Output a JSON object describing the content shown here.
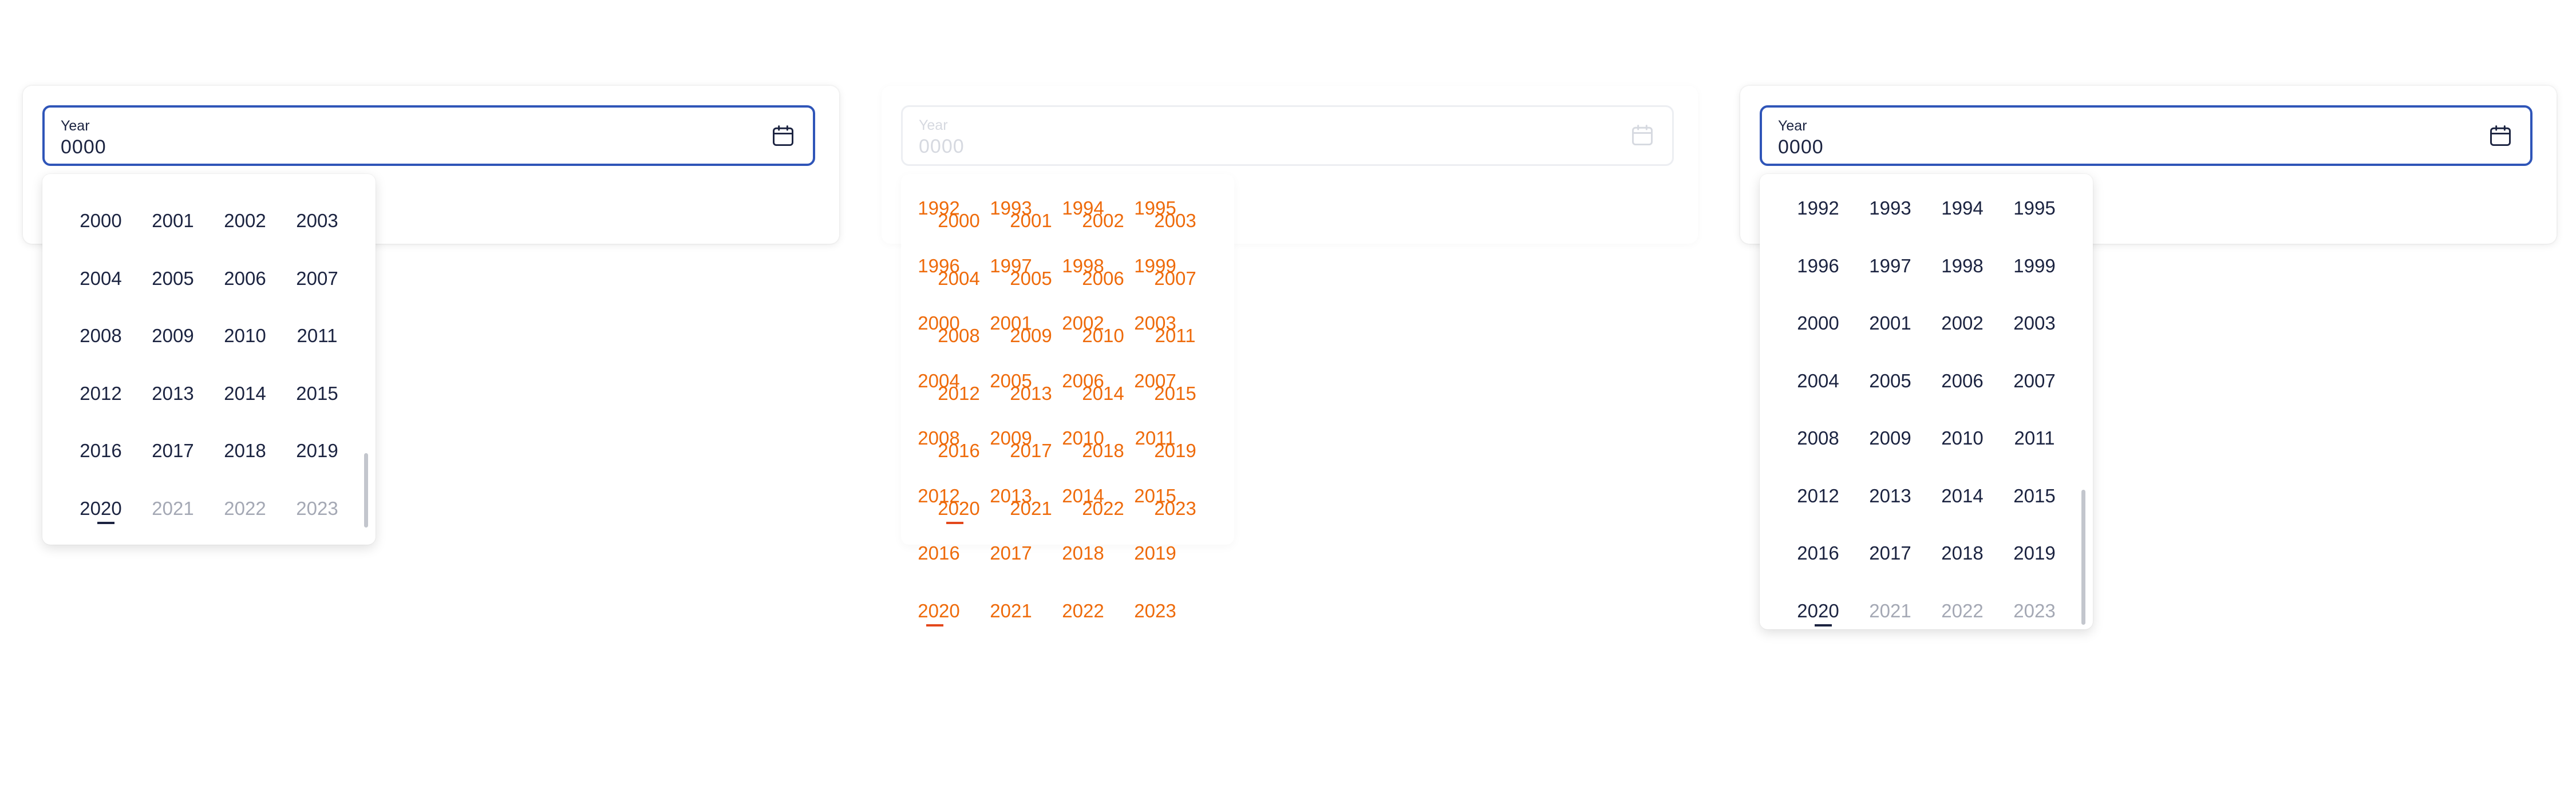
{
  "field": {
    "label": "Year",
    "value": "0000",
    "icon": "calendar-icon"
  },
  "colors": {
    "focus_border": "#2f55b8",
    "text": "#1b2340",
    "disabled": "#a4a8b4",
    "highlight": "#ee6a0a"
  },
  "panel_left": {
    "rows": [
      [
        {
          "year": "2000",
          "disabled": false
        },
        {
          "year": "2001",
          "disabled": false
        },
        {
          "year": "2002",
          "disabled": false
        },
        {
          "year": "2003",
          "disabled": false
        }
      ],
      [
        {
          "year": "2004",
          "disabled": false
        },
        {
          "year": "2005",
          "disabled": false
        },
        {
          "year": "2006",
          "disabled": false
        },
        {
          "year": "2007",
          "disabled": false
        }
      ],
      [
        {
          "year": "2008",
          "disabled": false
        },
        {
          "year": "2009",
          "disabled": false
        },
        {
          "year": "2010",
          "disabled": false
        },
        {
          "year": "2011",
          "disabled": false
        }
      ],
      [
        {
          "year": "2012",
          "disabled": false
        },
        {
          "year": "2013",
          "disabled": false
        },
        {
          "year": "2014",
          "disabled": false
        },
        {
          "year": "2015",
          "disabled": false
        }
      ],
      [
        {
          "year": "2016",
          "disabled": false
        },
        {
          "year": "2017",
          "disabled": false
        },
        {
          "year": "2018",
          "disabled": false
        },
        {
          "year": "2019",
          "disabled": false
        }
      ],
      [
        {
          "year": "2020",
          "disabled": false,
          "current": true
        },
        {
          "year": "2021",
          "disabled": true
        },
        {
          "year": "2022",
          "disabled": true
        },
        {
          "year": "2023",
          "disabled": true
        }
      ]
    ]
  },
  "panel_middle": {
    "layer_a_rows": [
      [
        "1992",
        "1993",
        "1994",
        "1995"
      ],
      [
        "1996",
        "1997",
        "1998",
        "1999"
      ],
      [
        "2000",
        "2001",
        "2002",
        "2003"
      ],
      [
        "2004",
        "2005",
        "2006",
        "2007"
      ],
      [
        "2008",
        "2009",
        "2010",
        "2011"
      ],
      [
        "2012",
        "2013",
        "2014",
        "2015"
      ],
      [
        "2016",
        "2017",
        "2018",
        "2019"
      ],
      [
        "2020",
        "2021",
        "2022",
        "2023"
      ]
    ],
    "layer_b_rows": [
      [
        "2000",
        "2001",
        "2002",
        "2003"
      ],
      [
        "2004",
        "2005",
        "2006",
        "2007"
      ],
      [
        "2008",
        "2009",
        "2010",
        "2011"
      ],
      [
        "2012",
        "2013",
        "2014",
        "2015"
      ],
      [
        "2016",
        "2017",
        "2018",
        "2019"
      ],
      [
        "2020",
        "2021",
        "2022",
        "2023"
      ]
    ]
  },
  "panel_right": {
    "rows": [
      [
        {
          "year": "1992",
          "disabled": false
        },
        {
          "year": "1993",
          "disabled": false
        },
        {
          "year": "1994",
          "disabled": false
        },
        {
          "year": "1995",
          "disabled": false
        }
      ],
      [
        {
          "year": "1996",
          "disabled": false
        },
        {
          "year": "1997",
          "disabled": false
        },
        {
          "year": "1998",
          "disabled": false
        },
        {
          "year": "1999",
          "disabled": false
        }
      ],
      [
        {
          "year": "2000",
          "disabled": false
        },
        {
          "year": "2001",
          "disabled": false
        },
        {
          "year": "2002",
          "disabled": false
        },
        {
          "year": "2003",
          "disabled": false
        }
      ],
      [
        {
          "year": "2004",
          "disabled": false
        },
        {
          "year": "2005",
          "disabled": false
        },
        {
          "year": "2006",
          "disabled": false
        },
        {
          "year": "2007",
          "disabled": false
        }
      ],
      [
        {
          "year": "2008",
          "disabled": false
        },
        {
          "year": "2009",
          "disabled": false
        },
        {
          "year": "2010",
          "disabled": false
        },
        {
          "year": "2011",
          "disabled": false
        }
      ],
      [
        {
          "year": "2012",
          "disabled": false
        },
        {
          "year": "2013",
          "disabled": false
        },
        {
          "year": "2014",
          "disabled": false
        },
        {
          "year": "2015",
          "disabled": false
        }
      ],
      [
        {
          "year": "2016",
          "disabled": false
        },
        {
          "year": "2017",
          "disabled": false
        },
        {
          "year": "2018",
          "disabled": false
        },
        {
          "year": "2019",
          "disabled": false
        }
      ],
      [
        {
          "year": "2020",
          "disabled": false,
          "current": true
        },
        {
          "year": "2021",
          "disabled": true
        },
        {
          "year": "2022",
          "disabled": true
        },
        {
          "year": "2023",
          "disabled": true
        }
      ]
    ]
  }
}
